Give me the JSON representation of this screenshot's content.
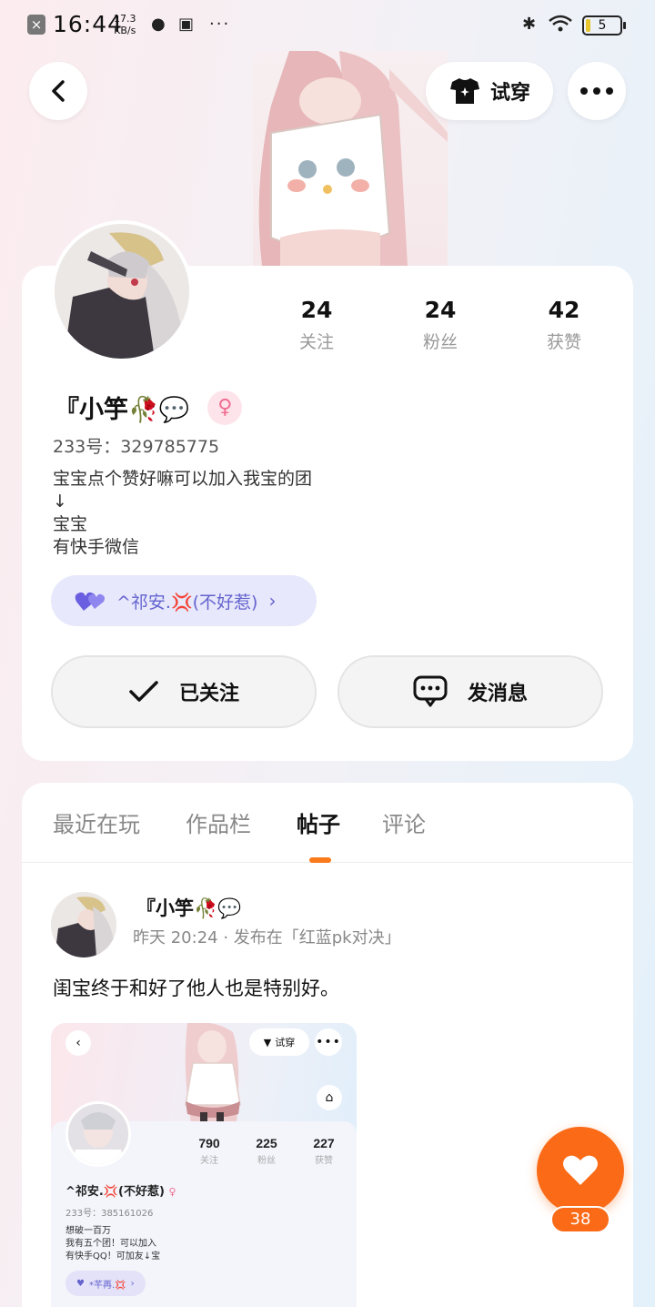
{
  "status_bar": {
    "time": "16:44",
    "speed_top": "17.3",
    "speed_unit": "KB/s",
    "battery": "5"
  },
  "header": {
    "tryon_label": "试穿"
  },
  "profile": {
    "stats": [
      {
        "value": "24",
        "label": "关注"
      },
      {
        "value": "24",
        "label": "粉丝"
      },
      {
        "value": "42",
        "label": "获赞"
      }
    ],
    "name": "『小竽🥀💬",
    "uid": "233号：329785775",
    "bio": [
      "宝宝点个赞好嘛可以加入我宝的团",
      "↓",
      "宝宝",
      "有快手微信"
    ],
    "group": "^祁安.💢(不好惹)",
    "follow_label": "已关注",
    "message_label": "发消息"
  },
  "tabs": [
    "最近在玩",
    "作品栏",
    "帖子",
    "评论"
  ],
  "post": {
    "author": "『小竽🥀💬",
    "meta": "昨天 20:24 · 发布在「红蓝pk对决」",
    "text": "闺宝终于和好了他人也是特别好。",
    "screenshot": {
      "tryon": "试穿",
      "stats": [
        {
          "value": "790",
          "label": "关注"
        },
        {
          "value": "225",
          "label": "粉丝"
        },
        {
          "value": "227",
          "label": "获赞"
        }
      ],
      "name": "^祁安.💢(不好惹)",
      "uid": "233号：385161026",
      "bio": [
        "想破一百万",
        "我有五个团！可以加入",
        "有快手QQ！可加友↓宝"
      ],
      "group": "*芊再.💢"
    }
  },
  "like": {
    "count": "38"
  },
  "colors": {
    "accent": "#fa6a17",
    "group_pill": "#e7e8fb",
    "group_text": "#6463cf"
  }
}
